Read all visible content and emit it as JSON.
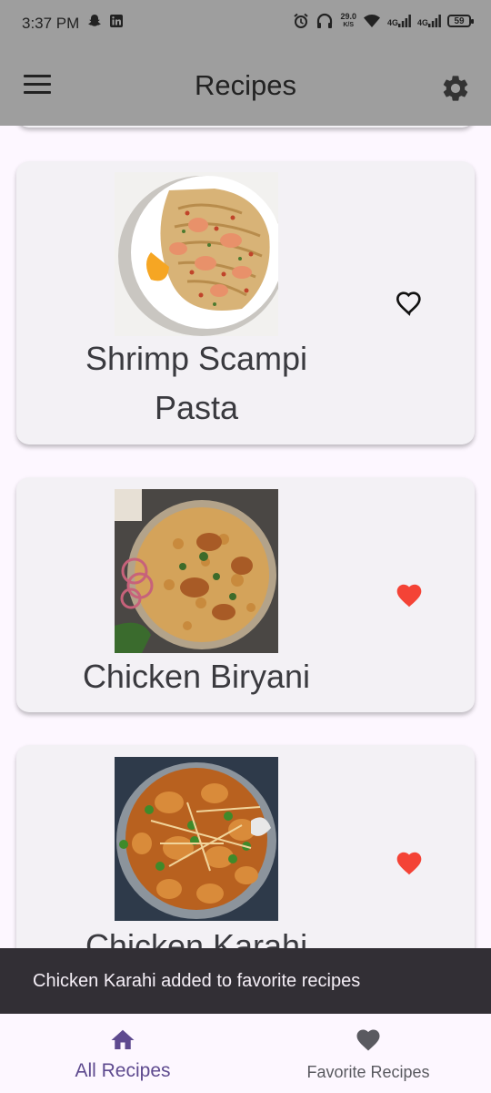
{
  "status_bar": {
    "time": "3:37 PM",
    "speed_value": "29.0",
    "speed_unit": "K/S",
    "network_1": "4G",
    "network_2": "4G",
    "battery": "59"
  },
  "app_bar": {
    "title": "Recipes",
    "menu_icon": "hamburger-menu-icon",
    "settings_icon": "gear-icon"
  },
  "recipes": [
    {
      "title": "Shrimp Scampi Pasta",
      "favorite": false
    },
    {
      "title": "Chicken Biryani",
      "favorite": true
    },
    {
      "title": "Chicken Karahi",
      "favorite": true
    }
  ],
  "snackbar": {
    "message": "Chicken Karahi added to favorite recipes"
  },
  "bottom_nav": {
    "items": [
      {
        "label": "All Recipes",
        "icon": "home-icon",
        "active": true
      },
      {
        "label": "Favorite Recipes",
        "icon": "heart-icon",
        "active": false
      }
    ]
  },
  "colors": {
    "app_bar": "#9e9e9e",
    "favorite_red": "#f44336",
    "active_nav": "#5e4a8f",
    "inactive_nav": "#5a5a60",
    "card_bg": "#f3f1f5",
    "snackbar_bg": "#322f35"
  }
}
